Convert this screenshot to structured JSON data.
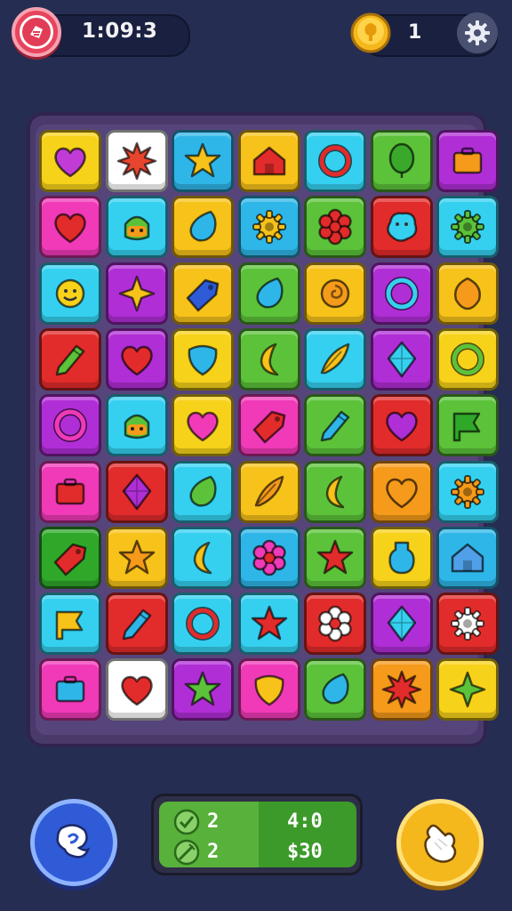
{
  "hud": {
    "timer": "1:09:3",
    "coins": "1"
  },
  "stats": {
    "left_top": "2",
    "left_bottom": "2",
    "right_top": "4:0",
    "right_bottom": "$30"
  },
  "board": {
    "rows": [
      [
        {
          "c": "#f7d21a",
          "i": "heart",
          "f": "#c13bd6"
        },
        {
          "c": "#ffffff",
          "i": "burst",
          "f": "#e8452e"
        },
        {
          "c": "#2fb6e8",
          "i": "star",
          "f": "#f7c21a"
        },
        {
          "c": "#f7c21a",
          "i": "house",
          "f": "#e22b2b"
        },
        {
          "c": "#35d0f0",
          "i": "ring",
          "f": "#e22b2b"
        },
        {
          "c": "#5cc23a",
          "i": "balloon",
          "f": "#3aa82a"
        },
        {
          "c": "#b02ed6",
          "i": "box",
          "f": "#f59a1a"
        }
      ],
      [
        {
          "c": "#f03ab8",
          "i": "heart",
          "f": "#e22b2b"
        },
        {
          "c": "#35d0f0",
          "i": "face",
          "f": "#5cc23a"
        },
        {
          "c": "#f7c21a",
          "i": "drop",
          "f": "#2fb6e8"
        },
        {
          "c": "#2fb6e8",
          "i": "gear",
          "f": "#f7c21a"
        },
        {
          "c": "#5cc23a",
          "i": "flower",
          "f": "#e22b2b"
        },
        {
          "c": "#e22b2b",
          "i": "blob",
          "f": "#35d0f0"
        },
        {
          "c": "#35d0f0",
          "i": "gear",
          "f": "#5cc23a"
        }
      ],
      [
        {
          "c": "#35d0f0",
          "i": "smile",
          "f": "#f7d21a"
        },
        {
          "c": "#b02ed6",
          "i": "cross",
          "f": "#f7c21a"
        },
        {
          "c": "#f7c21a",
          "i": "tag",
          "f": "#2f5bd6"
        },
        {
          "c": "#5cc23a",
          "i": "drop",
          "f": "#2fb6e8"
        },
        {
          "c": "#f7c21a",
          "i": "swirl",
          "f": "#f59a1a"
        },
        {
          "c": "#b02ed6",
          "i": "ring",
          "f": "#35d0f0"
        },
        {
          "c": "#f7c21a",
          "i": "leaf",
          "f": "#f59a1a"
        }
      ],
      [
        {
          "c": "#e22b2b",
          "i": "pencil",
          "f": "#5cc23a"
        },
        {
          "c": "#b02ed6",
          "i": "heart",
          "f": "#e22b2b"
        },
        {
          "c": "#f7d21a",
          "i": "shield",
          "f": "#2fb6e8"
        },
        {
          "c": "#5cc23a",
          "i": "moon",
          "f": "#f7c21a"
        },
        {
          "c": "#35d0f0",
          "i": "feather",
          "f": "#f7c21a"
        },
        {
          "c": "#b02ed6",
          "i": "diamond",
          "f": "#35d0f0"
        },
        {
          "c": "#f7d21a",
          "i": "ring",
          "f": "#5cc23a"
        }
      ],
      [
        {
          "c": "#b02ed6",
          "i": "ring",
          "f": "#f03ab8"
        },
        {
          "c": "#35d0f0",
          "i": "face",
          "f": "#5cc23a"
        },
        {
          "c": "#f7d21a",
          "i": "heart",
          "f": "#f03ab8"
        },
        {
          "c": "#f03ab8",
          "i": "tag",
          "f": "#e22b2b"
        },
        {
          "c": "#5cc23a",
          "i": "pencil",
          "f": "#2fb6e8"
        },
        {
          "c": "#e22b2b",
          "i": "heart",
          "f": "#b02ed6"
        },
        {
          "c": "#5cc23a",
          "i": "flag",
          "f": "#2fa82a"
        }
      ],
      [
        {
          "c": "#f03ab8",
          "i": "box",
          "f": "#e22b2b"
        },
        {
          "c": "#e22b2b",
          "i": "diamond",
          "f": "#b02ed6"
        },
        {
          "c": "#35d0f0",
          "i": "drop",
          "f": "#5cc23a"
        },
        {
          "c": "#f7c21a",
          "i": "feather",
          "f": "#f59a1a"
        },
        {
          "c": "#5cc23a",
          "i": "moon",
          "f": "#f7c21a"
        },
        {
          "c": "#f59a1a",
          "i": "heart",
          "f": "#f59a1a"
        },
        {
          "c": "#35d0f0",
          "i": "gear",
          "f": "#f59a1a"
        }
      ],
      [
        {
          "c": "#2fa82a",
          "i": "tag",
          "f": "#e22b2b"
        },
        {
          "c": "#f7c21a",
          "i": "star",
          "f": "#f59a1a"
        },
        {
          "c": "#35d0f0",
          "i": "moon",
          "f": "#f7c21a"
        },
        {
          "c": "#2fb6e8",
          "i": "flower",
          "f": "#f03ab8"
        },
        {
          "c": "#5cc23a",
          "i": "star",
          "f": "#e22b2b"
        },
        {
          "c": "#f7d21a",
          "i": "bottle",
          "f": "#2fb6e8"
        },
        {
          "c": "#2fb6e8",
          "i": "house",
          "f": "#4fa0e8"
        }
      ],
      [
        {
          "c": "#35d0f0",
          "i": "flag",
          "f": "#f7c21a"
        },
        {
          "c": "#e22b2b",
          "i": "pencil",
          "f": "#2fb6e8"
        },
        {
          "c": "#35d0f0",
          "i": "ring",
          "f": "#e22b2b"
        },
        {
          "c": "#35d0f0",
          "i": "star",
          "f": "#e22b2b"
        },
        {
          "c": "#e22b2b",
          "i": "flower",
          "f": "#ffffff"
        },
        {
          "c": "#b02ed6",
          "i": "diamond",
          "f": "#35d0f0"
        },
        {
          "c": "#e22b2b",
          "i": "gear",
          "f": "#ffffff"
        }
      ],
      [
        {
          "c": "#f03ab8",
          "i": "box",
          "f": "#2fb6e8"
        },
        {
          "c": "#ffffff",
          "i": "heart",
          "f": "#e22b2b"
        },
        {
          "c": "#b02ed6",
          "i": "star",
          "f": "#5cc23a"
        },
        {
          "c": "#f03ab8",
          "i": "shield",
          "f": "#f7c21a"
        },
        {
          "c": "#5cc23a",
          "i": "drop",
          "f": "#2fb6e8"
        },
        {
          "c": "#f59a1a",
          "i": "burst",
          "f": "#e22b2b"
        },
        {
          "c": "#f7d21a",
          "i": "cross",
          "f": "#5cc23a"
        }
      ]
    ]
  }
}
